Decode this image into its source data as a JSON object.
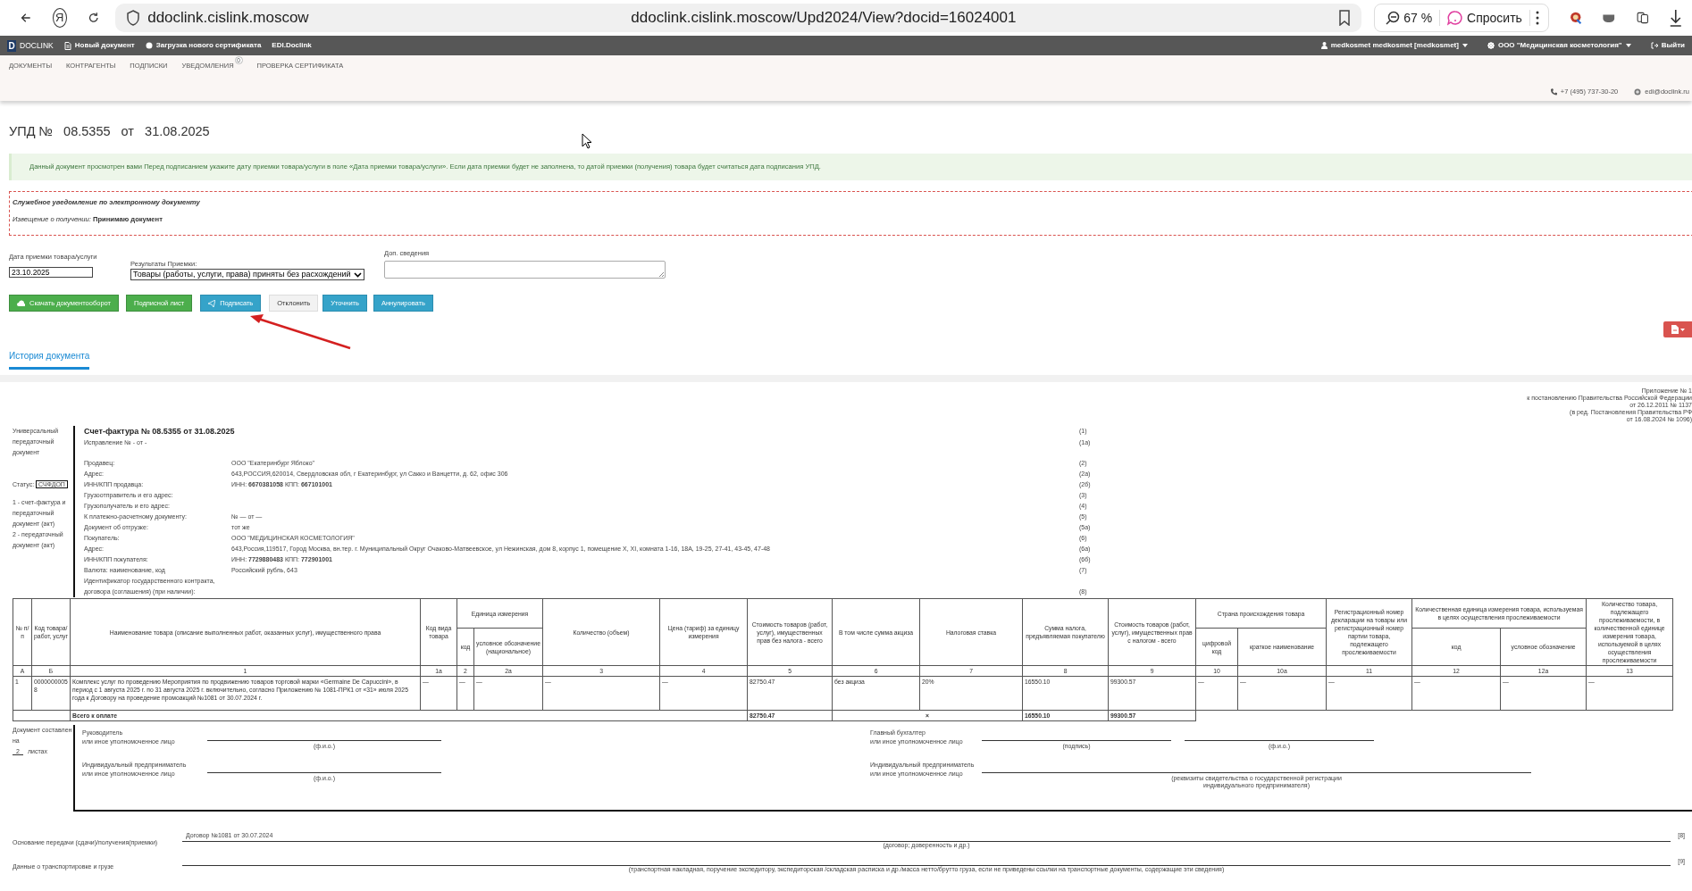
{
  "browser": {
    "logo": "Я",
    "domain": "ddoclink.cislink.moscow",
    "url": "ddoclink.cislink.moscow/Upd2024/View?docid=16024001",
    "zoom": "67 %",
    "ask": "Спросить"
  },
  "navbar": {
    "logo": "D",
    "brand": "DOCLINK",
    "links": [
      "Новый документ",
      "Загрузка нового сертификата",
      "EDI.Doclink"
    ],
    "user": "medkosmet medkosmet [medkosmet]",
    "org": "ООО \"Медицинская косметология\"",
    "logout": "Выйти"
  },
  "subnav": {
    "items": [
      {
        "label": "ДОКУМЕНТЫ"
      },
      {
        "label": "КОНТРАГЕНТЫ"
      },
      {
        "label": "ПОДПИСКИ"
      },
      {
        "label": "УВЕДОМЛЕНИЯ",
        "badge": "0"
      },
      {
        "label": "ПРОВЕРКА СЕРТИФИКАТА"
      }
    ],
    "phone": "+7 (495) 737-30-20",
    "email": "edi@doclink.ru"
  },
  "title": "УПД №   08.5355   от   31.08.2025",
  "alert": "Данный документ просмотрен вами  Перед подписанием укажите дату приемки товара/услуги в поле «Дата приемки товара/услуги». Если дата приемки будет не заполнена, то датой приемки (получения) товара будет считаться дата подписания УПД.",
  "notice": {
    "title": "Служебное уведомление по электронному документу",
    "label": "Извещение о получении:",
    "value": "Принимаю документ"
  },
  "form": {
    "date_label": "Дата приемки товара/услуги",
    "date_value": "23.10.2025",
    "result_label": "Результаты Приемки:",
    "result_value": "Товары (работы, услуги, права) приняты без расхождений",
    "extra_label": "Доп. сведения"
  },
  "buttons": [
    {
      "label": "Скачать документооборот",
      "kind": "download"
    },
    {
      "label": "Подписной лист",
      "kind": "sheet"
    },
    {
      "label": "Подписать",
      "kind": "sign"
    },
    {
      "label": "Отклонить",
      "kind": "reject"
    },
    {
      "label": "Уточнить",
      "kind": "clarify"
    },
    {
      "label": "Аннулировать",
      "kind": "annul"
    }
  ],
  "tabs": [
    {
      "label": "История документа",
      "selected": true
    }
  ],
  "document": {
    "appendix": [
      "Приложение № 1",
      "к постановлению Правительства Российской Федерации",
      "от 26.12.2011 № 1137",
      "(в ред. Постановления Правительства РФ",
      "от 16.08.2024 № 1096)"
    ],
    "doc_type": "Универсальный передаточный документ",
    "status_label": "Статус:",
    "status": "СЧФДОП",
    "legend": [
      "1 - счет-фактура и передаточный документ (акт)",
      "2 - передаточный документ (акт)"
    ],
    "invoice_title": "Счет-фактура № 08.5355  от 31.08.2025",
    "invoice_code": "(1)",
    "correction": "Исправление № - от -",
    "correction_code": "(1а)",
    "fields": [
      {
        "label": "Продавец:",
        "value": "ООО \"Екатеринбург Яблоко\"",
        "code": "(2)"
      },
      {
        "label": "Адрес:",
        "value": "643,РОССИЯ,620014, Свердловская обл, г Екатеринбург, ул Сакко и Ванцетти, д. 62, офис 306",
        "code": "(2а)"
      },
      {
        "label": "ИНН/КПП продавца:",
        "value": "ИНН: **6670381058** КПП: **667101001**",
        "code": "(2б)"
      },
      {
        "label": "Грузоотправитель и его адрес:",
        "code": "(3)"
      },
      {
        "label": "Грузополучатель и его адрес:",
        "code": "(4)"
      },
      {
        "label": "К платежно-расчетному документу:",
        "value": "№   — от  —",
        "code": "(5)"
      },
      {
        "label": "Документ об отгрузке:",
        "value": "тот же",
        "code": "(5а)"
      },
      {
        "label": "Покупатель:",
        "value": "ООО \"МЕДИЦИНСКАЯ КОСМЕТОЛОГИЯ\"",
        "code": "(6)"
      },
      {
        "label": "Адрес:",
        "value": "643,Россия,119517, Город Москва, вн.тер. г. Муниципальный Округ Очаково-Матвеевское, ул Нежинская, дом 8, корпус 1, помещение X, XI, комната 1-16, 18А, 19-25, 27-41, 43-45, 47-48",
        "code": "(6а)"
      },
      {
        "label": "ИНН/КПП покупателя:",
        "value": "ИНН: **7729880483** КПП: **772901001**",
        "code": "(6б)"
      },
      {
        "label": "Валюта: наименование, код",
        "value": "Российский рубль,  643",
        "code": "(7)"
      },
      {
        "label": "Идентификатор государственного контракта, договора (соглашения) (при наличии):",
        "code": "(8)"
      }
    ]
  },
  "table": {
    "columns": [
      {
        "title": "№ п/п",
        "number": "А"
      },
      {
        "title": "Код товара/ работ, услуг",
        "number": "Б"
      },
      {
        "title": "Наименование товара (описание выполненных работ, оказанных услуг), имущественного права",
        "number": "1"
      },
      {
        "title": "Код вида товара",
        "number": "1а"
      },
      {
        "title": "Единица измерения",
        "colspan": 2,
        "children": [
          {
            "title": "код",
            "number": "2"
          },
          {
            "title": "условное обозначение (национальное)",
            "number": "2а"
          }
        ]
      },
      {
        "title": "Количество (объем)",
        "number": "3"
      },
      {
        "title": "Цена (тариф) за единицу измерения",
        "number": "4"
      },
      {
        "title": "Стоимость товаров (работ, услуг), имущественных прав без налога - всего",
        "number": "5"
      },
      {
        "title": "В том числе сумма акциза",
        "number": "6"
      },
      {
        "title": "Налоговая ставка",
        "number": "7"
      },
      {
        "title": "Сумма налога, предъявляемая покупателю",
        "number": "8"
      },
      {
        "title": "Стоимость товаров (работ, услуг), имущественных прав с налогом - всего",
        "number": "9"
      },
      {
        "title": "Страна происхождения товара",
        "colspan": 2,
        "children": [
          {
            "title": "цифровой код",
            "number": "10"
          },
          {
            "title": "краткое наименование",
            "number": "10а"
          }
        ]
      },
      {
        "title": "Регистрационный номер декларации на товары или регистрационный номер партии товара, подлежащего прослеживаемости",
        "number": "11"
      },
      {
        "title": "Количественная единица измерения товара, используемая в целях осуществления прослеживаемости",
        "colspan": 2,
        "children": [
          {
            "title": "код",
            "number": "12"
          },
          {
            "title": "условное обозначение",
            "number": "12а"
          }
        ]
      },
      {
        "title": "Количество товара, подлежащего прослеживаемости, в количественной единице измерения товара, используемой в целях осуществления прослеживаемости",
        "number": "13"
      }
    ],
    "rows": [
      [
        "1",
        "00000000058",
        "Комплекс услуг по проведению Мероприятия по продвижению товаров торговой марки «Germaine De Capuccini», в период с 1 августа 2025 г. по 31 августа 2025 г. включительно, согласно Приложению № 1081-ПРК1 от «31» июля 2025 года к Договору на проведение промоакций №1081 от 30.07.2024 г.",
        "—",
        "—",
        "—",
        "—",
        "—",
        "82750.47",
        "без акциза",
        "20%",
        "16550.10",
        "99300.57",
        "—",
        "—",
        "—",
        "—",
        "—",
        "—"
      ]
    ],
    "total": {
      "label": "Всего к оплате",
      "cost_without_tax": "82750.47",
      "excise": "×",
      "tax": "16550.10",
      "cost_with_tax": "99300.57"
    }
  },
  "signatures": {
    "pages_before": "Документ составлен на",
    "pages": "2",
    "pages_after": "листах",
    "left": [
      {
        "title": "Руководитель",
        "subtitle": "или иное уполномоченное лицо",
        "captions": [
          "(ф.и.о.)"
        ]
      },
      {
        "title": "Индивидуальный предприниматель",
        "subtitle": "или иное уполномоченное лицо",
        "captions": [
          "(ф.и.о.)"
        ]
      }
    ],
    "right": [
      {
        "title": "Главный бухгалтер",
        "subtitle": "или иное уполномоченное лицо",
        "captions": [
          "(подпись)",
          "(ф.и.о.)"
        ]
      },
      {
        "title": "Индивидуальный предприниматель",
        "subtitle": "или иное уполномоченное лицо",
        "captions": [
          "(реквизиты свидетельства о государственной регистрации индивидуального предпринимателя)"
        ]
      }
    ]
  },
  "transfer": [
    {
      "label": "Основание передачи (сдачи)/получения(приемки)",
      "value": "Договор №1081 от 30.07.2024",
      "code": "[8]",
      "hint": "(договор; доверенность и др.)"
    },
    {
      "label": "Данные о транспортировке и грузе",
      "code": "[9]",
      "hint": "(транспортная накладная, поручение экспедитору, экспедиторская /складская расписка и др./масса нетто/брутто груза, если не приведены ссылки на транспортные документы, содержащие эти сведения)"
    }
  ]
}
